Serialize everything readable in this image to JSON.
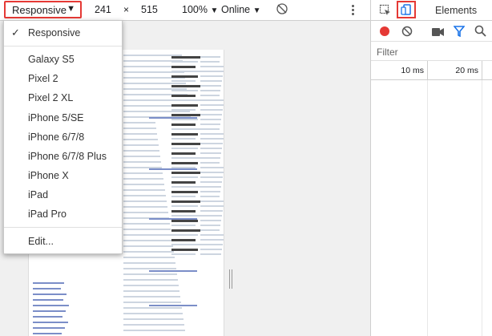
{
  "toolbar": {
    "device": "Responsive",
    "width": "241",
    "times": "×",
    "height": "515",
    "zoom": "100%",
    "network": "Online"
  },
  "devtools": {
    "tab_elements": "Elements",
    "filter_placeholder": "Filter",
    "timeline": {
      "t1": "10 ms",
      "t2": "20 ms"
    }
  },
  "dropdown": {
    "items": [
      {
        "label": "Responsive",
        "checked": true
      },
      {
        "label": "Galaxy S5"
      },
      {
        "label": "Pixel 2"
      },
      {
        "label": "Pixel 2 XL"
      },
      {
        "label": "iPhone 5/SE"
      },
      {
        "label": "iPhone 6/7/8"
      },
      {
        "label": "iPhone 6/7/8 Plus"
      },
      {
        "label": "iPhone X"
      },
      {
        "label": "iPad"
      },
      {
        "label": "iPad Pro"
      },
      {
        "label": "Edit..."
      }
    ]
  },
  "colors": {
    "highlight_border": "#e53935",
    "record_red": "#e53935",
    "active_blue": "#1a73e8"
  }
}
